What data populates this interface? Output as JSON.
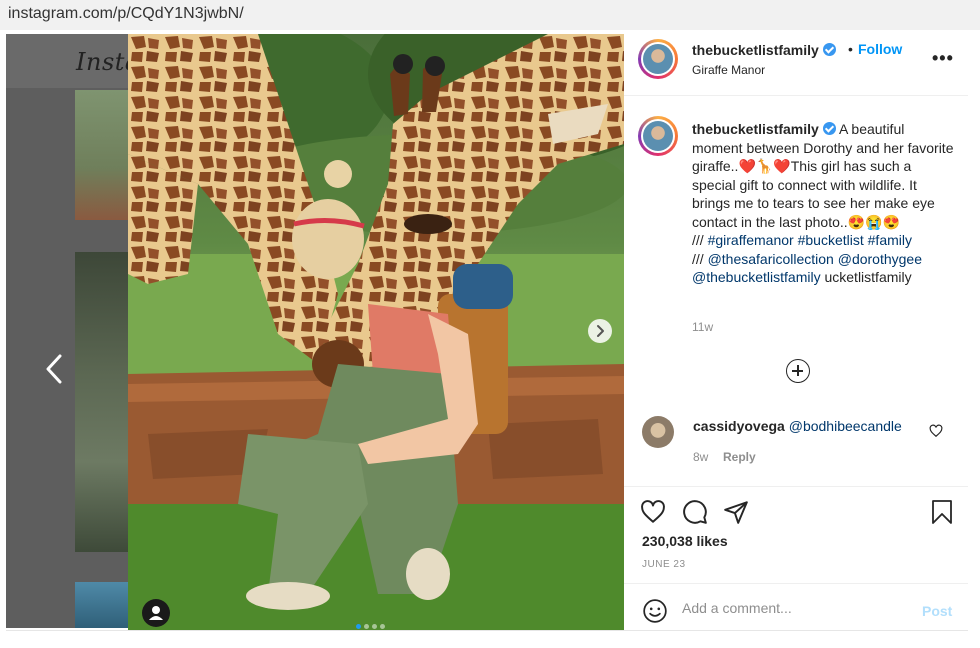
{
  "browser": {
    "url": "instagram.com/p/CQdY1N3jwbN/"
  },
  "backdrop": {
    "logo_text": "Insta"
  },
  "post": {
    "username": "thebucketlistfamily",
    "follow_separator": "•",
    "follow_label": "Follow",
    "location": "Giraffe Manor",
    "more_icon": "more-options-icon",
    "carousel": {
      "slide_count": 4,
      "current_slide": 1
    }
  },
  "caption": {
    "username": "thebucketlistfamily",
    "text_part1": "A beautiful moment between Dorothy and her favorite giraffe..",
    "emoji1": "❤️🦒❤️",
    "text_part2": "This girl has such a special gift to connect with wildlife. It brings me to tears to see her make eye contact in the last photo..",
    "emoji2": "😍😭😍",
    "prefix1": "/// ",
    "hashtags": [
      "#giraffemanor",
      "#bucketlist",
      "#family"
    ],
    "prefix2": "/// ",
    "mentions": [
      "@thesafaricollection",
      "@dorothygee",
      "@thebucketlistfamily"
    ],
    "trailing": "ucketlistfamily",
    "time": "11w"
  },
  "comment": {
    "username": "cassidyovega",
    "mention": "@bodhibeecandle",
    "time": "8w",
    "reply_label": "Reply"
  },
  "engagement": {
    "likes": "230,038 likes",
    "date": "JUNE 23"
  },
  "add_comment": {
    "placeholder": "Add a comment...",
    "post_label": "Post"
  },
  "colors": {
    "accent": "#0095f6",
    "link": "#00376b",
    "verified": "#3897f0",
    "post_disabled": "#b2dffc",
    "carousel_dot": "#1f9bf0"
  }
}
